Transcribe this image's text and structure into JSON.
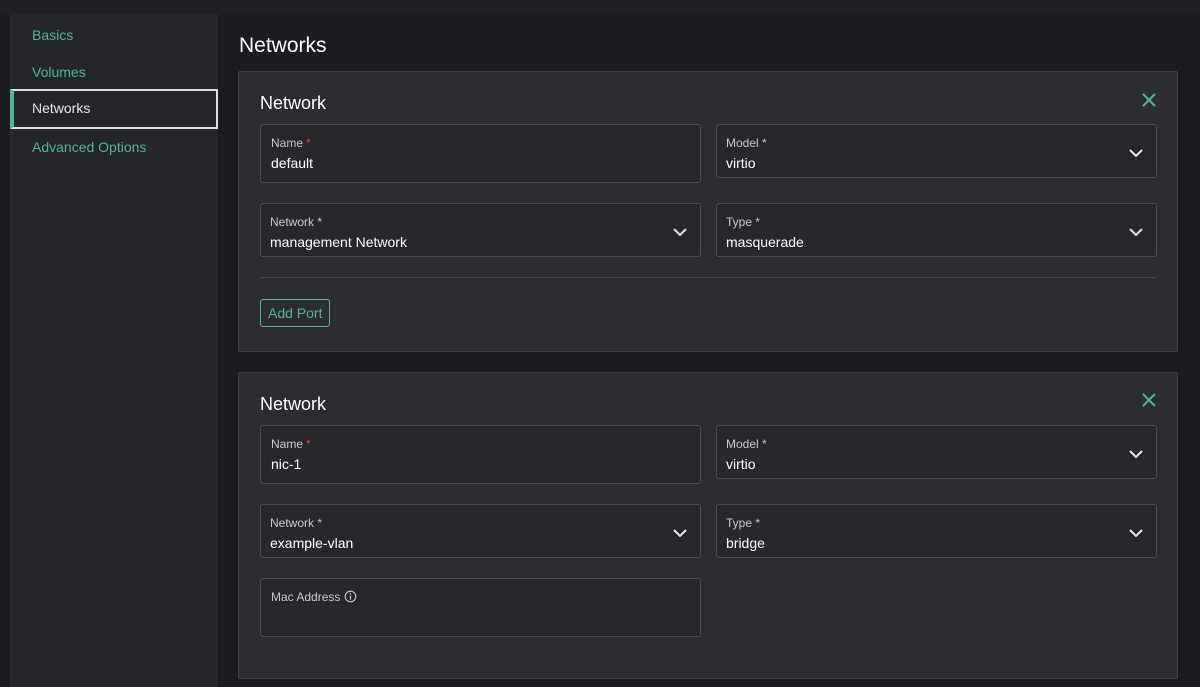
{
  "sidebar": {
    "items": [
      {
        "label": "Basics"
      },
      {
        "label": "Volumes"
      },
      {
        "label": "Networks",
        "active": true
      },
      {
        "label": "Advanced Options"
      }
    ]
  },
  "page": {
    "title": "Networks"
  },
  "networks": [
    {
      "title": "Network",
      "name_label": "Name",
      "name_value": "default",
      "model_label": "Model *",
      "model_value": "virtio",
      "network_label": "Network *",
      "network_value": "management Network",
      "type_label": "Type *",
      "type_value": "masquerade",
      "add_port_label": "Add Port"
    },
    {
      "title": "Network",
      "name_label": "Name",
      "name_value": "nic-1",
      "model_label": "Model *",
      "model_value": "virtio",
      "network_label": "Network *",
      "network_value": "example-vlan",
      "type_label": "Type *",
      "type_value": "bridge",
      "mac_label": "Mac Address",
      "mac_value": ""
    }
  ],
  "required_marker": "*",
  "colors": {
    "accent": "#4fb49a",
    "required": "#e0453c",
    "background": "#1b1c20",
    "card": "#2c2d32"
  }
}
